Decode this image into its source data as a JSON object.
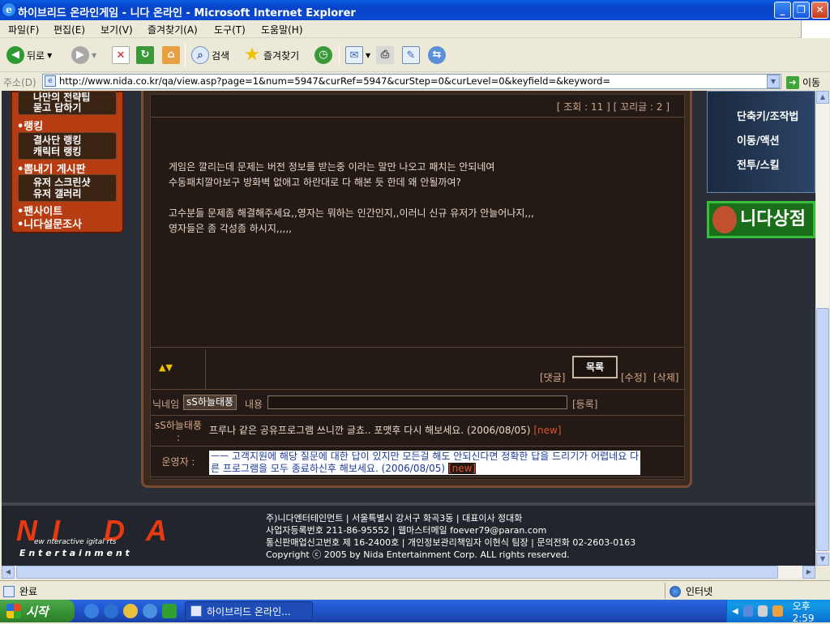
{
  "window": {
    "title": "하이브리드 온라인게임 - 니다 온라인 - Microsoft Internet Explorer",
    "buttons": {
      "min": "_",
      "max": "❐",
      "close": "✕"
    }
  },
  "menu": [
    "파일(F)",
    "편집(E)",
    "보기(V)",
    "즐겨찾기(A)",
    "도구(T)",
    "도움말(H)"
  ],
  "toolbar": {
    "back": "뒤로",
    "search": "검색",
    "favorites": "즐겨찾기"
  },
  "address": {
    "label": "주소(D)",
    "url": "http://www.nida.co.kr/qa/view.asp?page=1&num=5947&curRef=5947&curStep=0&curLevel=0&keyfield=&keyword=",
    "go": "이동"
  },
  "leftmenu": {
    "top_item_1": "나만의 전략팁",
    "top_item_2": "묻고 답하기",
    "sections": [
      {
        "title": "•랭킹",
        "items": [
          "결사단 랭킹",
          "캐릭터 랭킹"
        ]
      },
      {
        "title": "•뽐내기 게시판",
        "items": [
          "유저 스크린샷",
          "유저 갤러리"
        ]
      }
    ],
    "extra": [
      "•팬사이트",
      "•니다설문조사"
    ]
  },
  "post": {
    "view_info": "[ 조회 : 11 ] [ 꼬리글 : 2 ]",
    "lines": [
      "게임은 깔리는데 문제는 버전 정보를 받는중 이라는 말만 나오고 패치는 안되네여",
      "수동패치깔아보구 방화벽 없애고 하란대로 다 해본 듯 한데 왜 안될까여?",
      "",
      "고수분들 문제좀 해결해주세요,,영자는 뭐하는 인간인지,,이러니 신규 유저가 안늘어나지,,,",
      "영자들은 좀 각성좀 하시지,,,,,"
    ],
    "arrows": "▲▼",
    "reply": "[댓글]",
    "list": "목록",
    "edit": "[수정]",
    "delete": "[삭제]"
  },
  "comment_form": {
    "nick_label": "닉네임",
    "nick": "sS하늘태풍",
    "content_label": "내용",
    "register": "[등록]"
  },
  "comments": [
    {
      "who": "sS하늘태풍 :",
      "msg": "프루나 같은 공유프로그램 쓰니깐 글쵸.. 포맷후 다시 해보세요. (2006/08/05)",
      "new": "[new]"
    },
    {
      "who": "운영자 :",
      "msg1": "ㅡㅡ 고객지원에 해당 질문에 대한 답이 있지만 모든걸 해도 안되신다면 정확한 답을 드리기가 어렵네요 다",
      "msg2": "른 프로그램을 모두 종료하신후 해보세요. (2006/08/05)",
      "new": "[new]"
    }
  ],
  "right": {
    "menu": [
      "단축키/조작법",
      "이동/액션",
      "전투/스킬"
    ],
    "shop": "니다상점"
  },
  "footer": {
    "logo_n": "N",
    "logo_i": "I",
    "logo_d": "D",
    "logo_a": "A",
    "logo_words": "ew  nteractive  igital  rts",
    "logo_ent": "E n t e r t a i n m e n t",
    "lines": [
      "주)니다엔터테인먼트  |  서울특별시 강서구 화곡3동                              |  대표이사 정대화",
      "사업자등록번호 211-86-95552                              |   웹마스터메일   foever79@paran.com",
      "통신판매업신고번호 제 16-2400호 | 개인정보관리책임자 이현식 팀장  | 문의전화 02-2603-0163",
      "Copyright ⓒ 2005 by Nida Entertainment Corp. ALL rights reserved."
    ]
  },
  "status": {
    "done": "완료",
    "zone": "인터넷"
  },
  "taskbar": {
    "start": "시작",
    "task": "하이브리드 온라인...",
    "clock": "오후 2:59"
  }
}
